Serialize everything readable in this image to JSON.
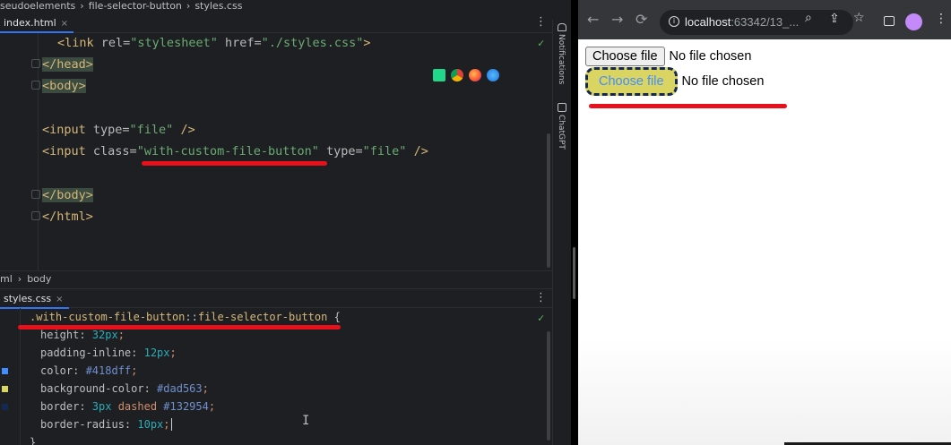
{
  "ide": {
    "breadcrumbs_top": [
      "seudoelements",
      "›",
      "file-selector-button",
      "›",
      "styles.css"
    ],
    "html_tab": {
      "label": "index.html",
      "close": "×"
    },
    "css_tab": {
      "label": "styles.css",
      "close": "×"
    },
    "menu": "⋮",
    "check": "✓",
    "html_code": {
      "line1": {
        "open": "<link ",
        "attr1": "rel=",
        "val1": "\"stylesheet\"",
        "attr2": " href=",
        "val2": "\"./styles.css\"",
        "close": ">"
      },
      "line2": "</head>",
      "line3": "<body>",
      "line5": {
        "open": "<input ",
        "attr1": "type=",
        "val1": "\"file\"",
        "close": " />"
      },
      "line6": {
        "open": "<input ",
        "attr1": "class=",
        "val1": "\"with-custom-file-button\"",
        "attr2": " type=",
        "val2": "\"file\"",
        "close": " />"
      },
      "line8": "</body>",
      "line9": "</html>"
    },
    "breadcrumb_mid": [
      "ml",
      "›",
      "body"
    ],
    "side_panel_labels": [
      "Notifications",
      "ChatGPT"
    ],
    "css_code": {
      "selector": ".with-custom-file-button",
      "pseudo_sep": "::",
      "pseudo": "file-selector-button",
      "brace_open": " {",
      "decls": [
        {
          "prop": "height: ",
          "value": "32px",
          "semi": ";"
        },
        {
          "prop": "padding-inline: ",
          "value": "12px",
          "semi": ";"
        },
        {
          "prop": "color: ",
          "value": "#418dff",
          "semi": ";"
        },
        {
          "prop": "background-color: ",
          "value": "#dad563",
          "semi": ";"
        },
        {
          "prop": "border: ",
          "value": "3px",
          "value2": " dashed ",
          "value3": "#132954",
          "semi": ";"
        },
        {
          "prop": "border-radius: ",
          "value": "10px",
          "semi": ";"
        }
      ],
      "brace_close": "}"
    },
    "swatch_colors": [
      "#418dff",
      "#dad563",
      "#132954"
    ]
  },
  "browser": {
    "url_host": "localhost",
    "url_rest": ":63342/13_...",
    "nav": {
      "back": "←",
      "forward": "→",
      "reload": "⟳"
    },
    "omnibox_icons": {
      "info": "i",
      "zoom": "⌕",
      "share": "⇪",
      "star": "☆"
    },
    "page": {
      "row1": {
        "button": "Choose file",
        "status": "No file chosen"
      },
      "row2": {
        "button": "Choose file",
        "status": "No file chosen"
      }
    },
    "menu": "⋮"
  },
  "colors": {
    "annotation_red": "#e8111b",
    "ide_bg": "#1e1f22",
    "custom_btn_bg": "#dad563",
    "custom_btn_text": "#418dff",
    "custom_btn_border": "#132954"
  }
}
